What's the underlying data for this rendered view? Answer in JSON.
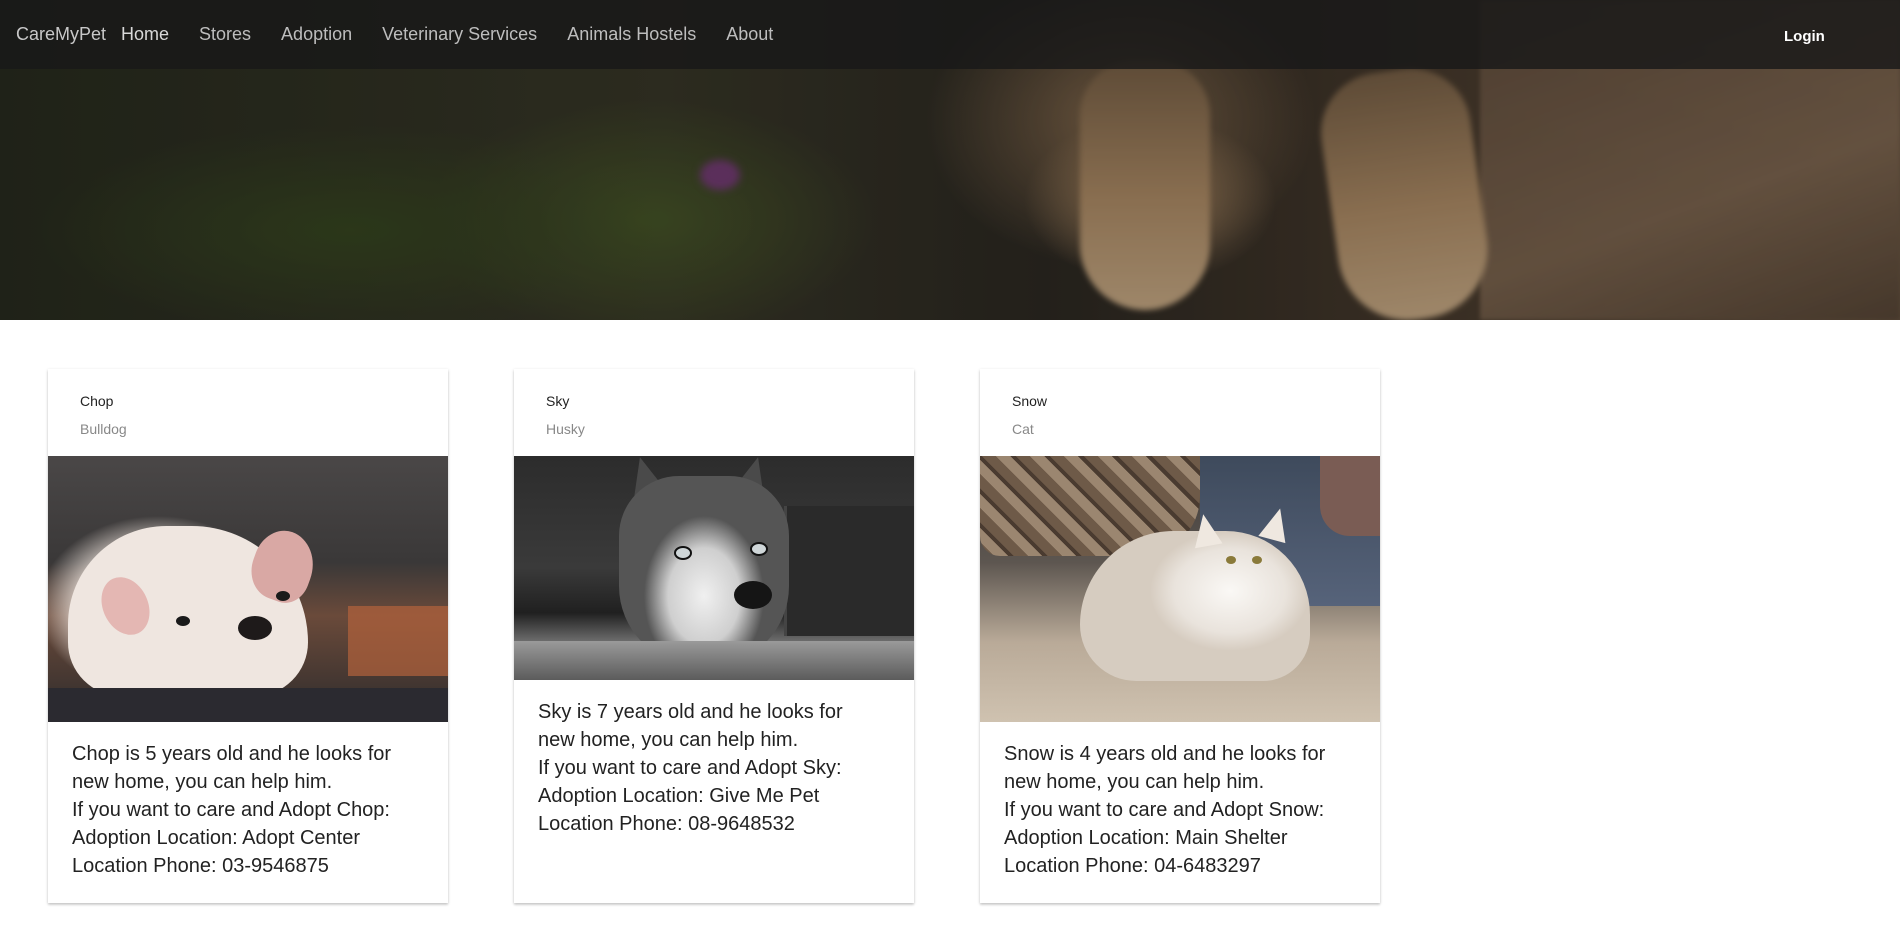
{
  "nav": {
    "brand": "CareMyPet",
    "links": [
      "Home",
      "Stores",
      "Adoption",
      "Veterinary Services",
      "Animals Hostels",
      "About"
    ],
    "login": "Login"
  },
  "cards": [
    {
      "name": "Chop",
      "breed": "Bulldog",
      "lines": [
        "Chop is 5 years old and he looks for",
        "new home, you can help him.",
        "If you want to care and Adopt Chop:",
        "Adoption Location: Adopt Center",
        "Location Phone: 03-9546875"
      ]
    },
    {
      "name": "Sky",
      "breed": "Husky",
      "lines": [
        "Sky is 7 years old and he looks for",
        "new home, you can help him.",
        "If you want to care and Adopt Sky:",
        "Adoption Location: Give Me Pet",
        "Location Phone: 08-9648532"
      ]
    },
    {
      "name": "Snow",
      "breed": "Cat",
      "lines": [
        "Snow is 4 years old and he looks for",
        "new home, you can help him.",
        "If you want to care and Adopt Snow:",
        "Adoption Location: Main Shelter",
        "Location Phone: 04-6483297"
      ]
    }
  ]
}
